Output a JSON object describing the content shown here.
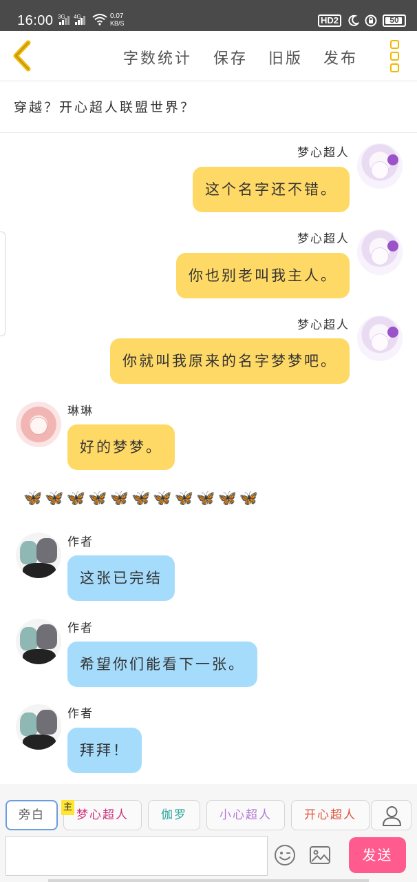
{
  "status_bar": {
    "time": "16:00",
    "sim1": "3G",
    "sim2": "4G",
    "net_speed": "0.07",
    "net_unit": "KB/S",
    "hd_label": "HD2",
    "battery": "50"
  },
  "toolbar": {
    "items": [
      "字数统计",
      "保存",
      "旧版",
      "发布"
    ]
  },
  "story": {
    "title": "穿越？开心超人联盟世界？"
  },
  "messages": [
    {
      "speaker": "梦心超人",
      "text": "这个名字还不错。",
      "side": "right",
      "color": "yellow"
    },
    {
      "speaker": "梦心超人",
      "text": "你也别老叫我主人。",
      "side": "right",
      "color": "yellow"
    },
    {
      "speaker": "梦心超人",
      "text": "你就叫我原来的名字梦梦吧。",
      "side": "right",
      "color": "yellow"
    },
    {
      "speaker": "琳琳",
      "text": "好的梦梦。",
      "side": "left",
      "color": "yellow"
    },
    {
      "speaker": "作者",
      "text": "这张已完结",
      "side": "left",
      "color": "blue"
    },
    {
      "speaker": "作者",
      "text": "希望你们能看下一张。",
      "side": "left",
      "color": "blue"
    },
    {
      "speaker": "作者",
      "text": "拜拜！",
      "side": "left",
      "color": "blue"
    }
  ],
  "narration_line": "🦋🦋🦋🦋🦋🦋🦋🦋🦋🦋🦋",
  "roles": [
    {
      "label": "旁白",
      "color": "#555555"
    },
    {
      "label": "梦心超人",
      "color": "#d0307a"
    },
    {
      "label": "伽罗",
      "color": "#2aa79b"
    },
    {
      "label": "小心超人",
      "color": "#b27ad6"
    },
    {
      "label": "开心超人",
      "color": "#e0513b"
    }
  ],
  "main_badge": "主",
  "input": {
    "placeholder": ""
  },
  "send_label": "发送",
  "colors": {
    "accent_yellow": "#f2b800",
    "bubble_yellow": "#ffd966",
    "bubble_blue": "#a6dcfb",
    "send_pink": "#ff5b8f"
  },
  "icons": [
    "back-chevron-icon",
    "more-menu-icon",
    "person-icon",
    "emoji-icon",
    "image-icon",
    "wifi-icon"
  ]
}
